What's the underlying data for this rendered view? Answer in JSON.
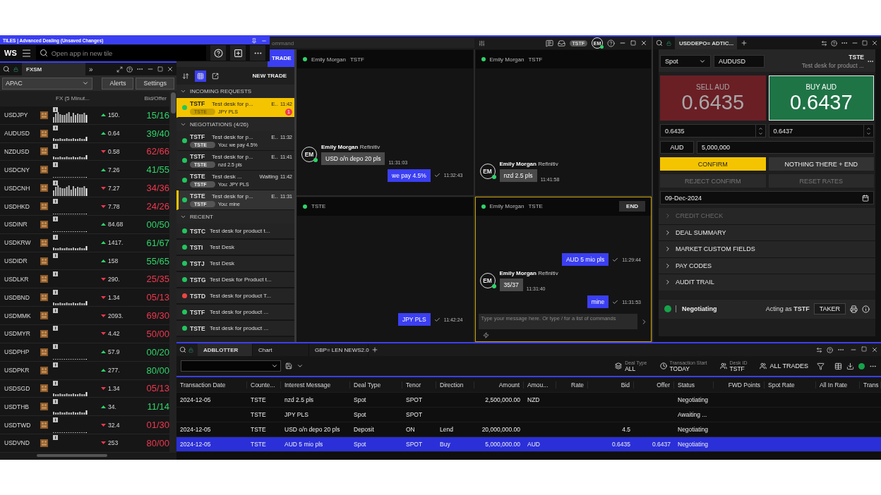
{
  "tiles_bar": {
    "title": "TILES | Advanced Dealing (Unsaved Changes)",
    "logo": "WS",
    "search": {
      "placeholder": "Open app in new tile"
    }
  },
  "fxsm": {
    "tab": "FXSM",
    "more": "»",
    "region": "APAC",
    "buttons": [
      "Alerts",
      "Settings"
    ],
    "columns": [
      "FX (5 Minut...",
      "Bid/Offer"
    ],
    "rows": [
      {
        "pair": "USDJPY",
        "rising": true,
        "change": "150.",
        "quote": "15/16",
        "kind": "tall"
      },
      {
        "pair": "AUDUSD",
        "rising": true,
        "change": "0.64",
        "quote": "39/40",
        "kind": "low"
      },
      {
        "pair": "NZDUSD",
        "rising": false,
        "change": "0.58",
        "quote": "62/66",
        "kind": "low"
      },
      {
        "pair": "USDCNY",
        "rising": true,
        "change": "7.26",
        "quote": "41/55",
        "kind": "faint"
      },
      {
        "pair": "USDCNH",
        "rising": false,
        "change": "7.27",
        "quote": "34/36",
        "kind": "tall"
      },
      {
        "pair": "USDHKD",
        "rising": false,
        "change": "7.78",
        "quote": "24/26",
        "kind": "faint"
      },
      {
        "pair": "USDINR",
        "rising": true,
        "change": "84.68",
        "quote": "00/50",
        "kind": "faint"
      },
      {
        "pair": "USDKRW",
        "rising": true,
        "change": "1417.",
        "quote": "61/67",
        "kind": "low"
      },
      {
        "pair": "USDIDR",
        "rising": true,
        "change": "158",
        "quote": "55/65",
        "kind": "blank"
      },
      {
        "pair": "USDLKR",
        "rising": false,
        "change": "290.",
        "quote": "25/35",
        "kind": "blank"
      },
      {
        "pair": "USDBND",
        "rising": false,
        "change": "1.34",
        "quote": "05/13",
        "kind": "low"
      },
      {
        "pair": "USDMMK",
        "rising": false,
        "change": "2093.",
        "quote": "69/30",
        "kind": "blank"
      },
      {
        "pair": "USDMYR",
        "rising": false,
        "change": "4.42",
        "quote": "50/00",
        "kind": "blank"
      },
      {
        "pair": "USDPHP",
        "rising": true,
        "change": "57.9",
        "quote": "00/20",
        "kind": "faint"
      },
      {
        "pair": "USDPKR",
        "rising": true,
        "change": "277.",
        "quote": "80/00",
        "kind": "blank"
      },
      {
        "pair": "USDSGD",
        "rising": false,
        "change": "1.34",
        "quote": "05/13",
        "kind": "low"
      },
      {
        "pair": "USDTHB",
        "rising": true,
        "change": "34.",
        "quote": "11/14",
        "kind": "low"
      },
      {
        "pair": "USDTWD",
        "rising": false,
        "change": "32.4",
        "quote": "01/30",
        "kind": "faint"
      },
      {
        "pair": "USDVND",
        "rising": false,
        "change": "253",
        "quote": "80/00",
        "kind": "blank"
      }
    ]
  },
  "command_bar": {
    "placeholder": "ommand",
    "badge": "TSTF",
    "avatar": "EM"
  },
  "trade_list": {
    "tab": "TRADE",
    "new_trade": "NEW TRADE",
    "sections": [
      {
        "title": "INCOMING REQUESTS",
        "expanded": true,
        "items": [
          {
            "kind": "request",
            "code": "TSTF",
            "desk": "Test desk for p...",
            "flag": "E..",
            "time": "11:42",
            "tag": "TSTE",
            "message": "JPY PLS",
            "badge": "1",
            "color": "#22c55e",
            "alert": true,
            "selected": false
          }
        ]
      },
      {
        "title": "NEGOTIATIONS (4/26)",
        "expanded": true,
        "items": [
          {
            "kind": "request",
            "code": "TSTF",
            "desk": "Test desk for p...",
            "flag": "E..",
            "time": "11:32",
            "tag": "TSTE",
            "message": "You: we pay 4.5%",
            "color": "#22c55e",
            "alert": false,
            "selected": false
          },
          {
            "kind": "request",
            "code": "TSTF",
            "desk": "Test desk for p...",
            "flag": "E..",
            "time": "11:41",
            "tag": "TSTE",
            "message": "nzd 2.5 pls",
            "color": "#22c55e",
            "alert": false,
            "selected": false
          },
          {
            "kind": "request",
            "code": "TSTE",
            "desk": "Test desk ...",
            "flag": "Waiting",
            "time": "11:42",
            "tag": "TSTF",
            "message": "You: JPY PLS",
            "color": "#22c55e",
            "alert": false,
            "selected": false
          },
          {
            "kind": "request",
            "code": "TSTE",
            "desk": "Test desk for p...",
            "flag": "E..",
            "time": "11:31",
            "tag": "TSTF",
            "message": "You: mine",
            "color": "#22c55e",
            "alert": false,
            "selected": true
          }
        ]
      },
      {
        "title": "RECENT",
        "expanded": true,
        "items": [
          {
            "kind": "recent",
            "code": "TSTC",
            "desk": "Test desk for product t...",
            "color": "#22c55e",
            "selected": false
          },
          {
            "kind": "recent",
            "code": "TSTI",
            "desk": "Test Desk",
            "color": "#22c55e",
            "selected": false
          },
          {
            "kind": "recent",
            "code": "TSTJ",
            "desk": "Test Desk",
            "color": "#22c55e",
            "selected": false
          },
          {
            "kind": "recent",
            "code": "TSTG",
            "desk": "Test Desk for Product t...",
            "color": "#22c55e",
            "selected": false
          },
          {
            "kind": "recent",
            "code": "TSTD",
            "desk": "Test desk for product T...",
            "color": "#ef4444",
            "selected": false
          },
          {
            "kind": "recent",
            "code": "TSTF",
            "desk": "Test desk for product ...",
            "color": "#22c55e",
            "selected": false
          },
          {
            "kind": "recent",
            "code": "TSTE",
            "desk": "Test desk for product ...",
            "color": "#22c55e",
            "selected": false
          }
        ]
      }
    ]
  },
  "chats": [
    {
      "contact": "Emily Morgan",
      "desk": "TSTF",
      "selected": false,
      "messages": [
        {
          "outgoing": false,
          "avatar": "EM",
          "sender": "Emily Morgan",
          "org": "Refinitiv",
          "text": "USD o/n depo 20 pls",
          "time": "11:31:03"
        },
        {
          "outgoing": true,
          "text": "we pay 4.5%",
          "time": "11:32:43"
        }
      ]
    },
    {
      "contact": "Emily Morgan",
      "desk": "TSTF",
      "selected": false,
      "messages": [
        {
          "outgoing": false,
          "avatar": "EM",
          "sender": "Emily Morgan",
          "org": "Refinitiv",
          "text": "nzd 2.5 pls",
          "time": "11:41:58"
        }
      ]
    },
    {
      "desk": "TSTE",
      "selected": false,
      "messages": [
        {
          "outgoing": true,
          "text": "JPY PLS",
          "time": "11:42:24"
        }
      ]
    },
    {
      "contact": "Emily Morgan",
      "desk": "TSTE",
      "selected": true,
      "end_button": "END",
      "input": {
        "placeholder": "Type your message here. Or type / for a list of commands"
      },
      "messages": [
        {
          "outgoing": true,
          "text": "AUD 5 mio pls",
          "time": "11:29:44"
        },
        {
          "outgoing": false,
          "avatar": "EM",
          "sender": "Emily Morgan",
          "org": "Refinitiv",
          "text": "35/37",
          "time": "11:31:40"
        },
        {
          "outgoing": true,
          "text": "mine",
          "time": "11:31:53"
        }
      ]
    }
  ],
  "ticket": {
    "tab": "USDDEPO= ADTIC...",
    "product": "Spot",
    "pair": "AUDUSD",
    "desk_code": "TSTE",
    "desk_name": "Test desk for product ...",
    "sides": [
      {
        "label": "SELL AUD",
        "price": "0.6435",
        "input": "0.6435",
        "color": "#6a1f25",
        "selected": false
      },
      {
        "label": "BUY AUD",
        "price": "0.6437",
        "input": "0.6437",
        "color": "#1f7446",
        "selected": true
      }
    ],
    "currency": "AUD",
    "amount": "5,000,000",
    "buttons": [
      {
        "label": "CONFIRM",
        "kind": "primary"
      },
      {
        "label": "NOTHING THERE + END",
        "kind": "normal"
      },
      {
        "label": "REJECT CONFIRM",
        "kind": "disabled"
      },
      {
        "label": "RESET RATES",
        "kind": "disabled"
      }
    ],
    "date": "09-Dec-2024",
    "sections": [
      {
        "label": "CREDIT CHECK",
        "disabled": true,
        "expanded": false
      },
      {
        "label": "DEAL SUMMARY",
        "disabled": false,
        "expanded": false
      },
      {
        "label": "MARKET CUSTOM FIELDS",
        "disabled": false,
        "expanded": false
      },
      {
        "label": "PAY CODES",
        "disabled": false,
        "expanded": false
      },
      {
        "label": "AUDIT TRAIL",
        "disabled": false,
        "expanded": false
      }
    ],
    "status": {
      "label": "Negotiating",
      "color": "#16a34a"
    },
    "acting": "Acting as **TSTF**",
    "role": "TAKER"
  },
  "blotter": {
    "tabs": [
      {
        "label": "ADBLOTTER",
        "selected": true
      },
      {
        "label": "Chart",
        "selected": false
      },
      {
        "label": "GBP= LEN NEWS2.0",
        "selected": false
      }
    ],
    "filters": [
      {
        "caption": "Deal Type",
        "value": "ALL"
      },
      {
        "caption": "Transaction Start",
        "value": "TODAY"
      },
      {
        "caption": "Desk ID",
        "value": "TSTF"
      }
    ],
    "all_trades": "ALL TRADES",
    "columns": [
      "Transaction Date",
      "Counte...",
      "Interest Message",
      "Deal Type",
      "Tenor",
      "Direction",
      "Amount",
      "Amou...",
      "Rate",
      "Bid",
      "Offer",
      "Status",
      "FWD Points",
      "Spot Rate",
      "All In Rate",
      "Trans"
    ],
    "rows": [
      {
        "selected": false,
        "cells": [
          "2024-12-05",
          "TSTE",
          "nzd 2.5 pls",
          "Spot",
          "SPOT",
          null,
          "2,500,000.00",
          "NZD",
          null,
          null,
          null,
          "Negotiating",
          null,
          null,
          null,
          null
        ]
      },
      {
        "selected": false,
        "cells": [
          null,
          "TSTE",
          "JPY PLS",
          "Spot",
          "SPOT",
          null,
          null,
          null,
          null,
          null,
          null,
          "Awaiting ...",
          null,
          null,
          null,
          null
        ]
      },
      {
        "selected": false,
        "cells": [
          "2024-12-05",
          "TSTE",
          "USD o/n depo 20 pls",
          "Deposit",
          "ON",
          "Lend",
          "20,000,000.00",
          null,
          null,
          "4.5",
          null,
          "Negotiating",
          null,
          null,
          null,
          null
        ]
      },
      {
        "selected": true,
        "cells": [
          "2024-12-05",
          "TSTE",
          "AUD 5 mio pls",
          "Spot",
          "SPOT",
          "Buy",
          "5,000,000.00",
          "AUD",
          null,
          "0.6435",
          "0.6437",
          "Negotiating",
          null,
          null,
          null,
          null
        ]
      }
    ]
  }
}
